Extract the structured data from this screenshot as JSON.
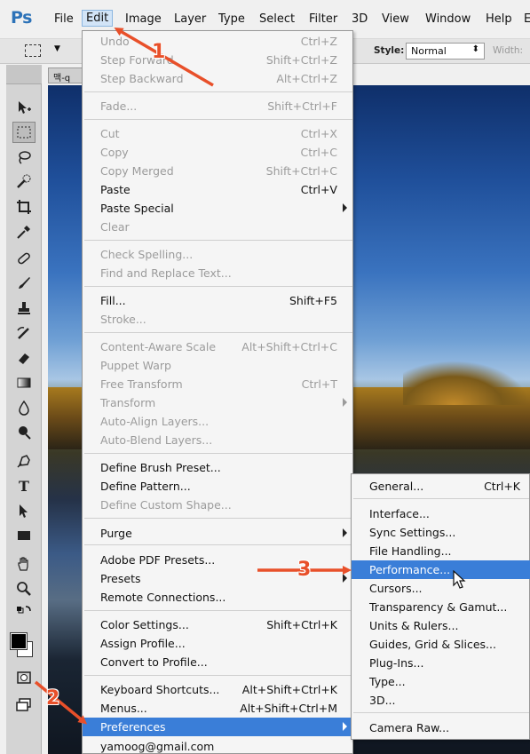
{
  "app": {
    "logo": "Ps"
  },
  "menubar": {
    "items": [
      "File",
      "Edit",
      "Image",
      "Layer",
      "Type",
      "Select",
      "Filter",
      "3D",
      "View",
      "Window",
      "Help",
      "E"
    ]
  },
  "options_bar": {
    "style_label": "Style:",
    "style_value": "Normal",
    "width_label": "Width:"
  },
  "document": {
    "tab_label": "맥-q"
  },
  "edit_menu": {
    "items": [
      {
        "label": "Undo",
        "shortcut": "Ctrl+Z",
        "disabled": true
      },
      {
        "label": "Step Forward",
        "shortcut": "Shift+Ctrl+Z",
        "disabled": true
      },
      {
        "label": "Step Backward",
        "shortcut": "Alt+Ctrl+Z",
        "disabled": true
      },
      {
        "label": "Fade...",
        "shortcut": "Shift+Ctrl+F",
        "disabled": true
      },
      {
        "label": "Cut",
        "shortcut": "Ctrl+X",
        "disabled": true
      },
      {
        "label": "Copy",
        "shortcut": "Ctrl+C",
        "disabled": true
      },
      {
        "label": "Copy Merged",
        "shortcut": "Shift+Ctrl+C",
        "disabled": true
      },
      {
        "label": "Paste",
        "shortcut": "Ctrl+V",
        "disabled": false
      },
      {
        "label": "Paste Special",
        "shortcut": "",
        "disabled": false,
        "submenu": true
      },
      {
        "label": "Clear",
        "shortcut": "",
        "disabled": true
      },
      {
        "label": "Check Spelling...",
        "shortcut": "",
        "disabled": true
      },
      {
        "label": "Find and Replace Text...",
        "shortcut": "",
        "disabled": true
      },
      {
        "label": "Fill...",
        "shortcut": "Shift+F5",
        "disabled": false
      },
      {
        "label": "Stroke...",
        "shortcut": "",
        "disabled": true
      },
      {
        "label": "Content-Aware Scale",
        "shortcut": "Alt+Shift+Ctrl+C",
        "disabled": true
      },
      {
        "label": "Puppet Warp",
        "shortcut": "",
        "disabled": true
      },
      {
        "label": "Free Transform",
        "shortcut": "Ctrl+T",
        "disabled": true
      },
      {
        "label": "Transform",
        "shortcut": "",
        "disabled": true,
        "submenu": true
      },
      {
        "label": "Auto-Align Layers...",
        "shortcut": "",
        "disabled": true
      },
      {
        "label": "Auto-Blend Layers...",
        "shortcut": "",
        "disabled": true
      },
      {
        "label": "Define Brush Preset...",
        "shortcut": "",
        "disabled": false
      },
      {
        "label": "Define Pattern...",
        "shortcut": "",
        "disabled": false
      },
      {
        "label": "Define Custom Shape...",
        "shortcut": "",
        "disabled": true
      },
      {
        "label": "Purge",
        "shortcut": "",
        "disabled": false,
        "submenu": true
      },
      {
        "label": "Adobe PDF Presets...",
        "shortcut": "",
        "disabled": false
      },
      {
        "label": "Presets",
        "shortcut": "",
        "disabled": false,
        "submenu": true
      },
      {
        "label": "Remote Connections...",
        "shortcut": "",
        "disabled": false
      },
      {
        "label": "Color Settings...",
        "shortcut": "Shift+Ctrl+K",
        "disabled": false
      },
      {
        "label": "Assign Profile...",
        "shortcut": "",
        "disabled": false
      },
      {
        "label": "Convert to Profile...",
        "shortcut": "",
        "disabled": false
      },
      {
        "label": "Keyboard Shortcuts...",
        "shortcut": "Alt+Shift+Ctrl+K",
        "disabled": false
      },
      {
        "label": "Menus...",
        "shortcut": "Alt+Shift+Ctrl+M",
        "disabled": false
      },
      {
        "label": "Preferences",
        "shortcut": "",
        "disabled": false,
        "submenu": true,
        "highlighted": true
      },
      {
        "label": "yamoog@gmail.com",
        "shortcut": "",
        "disabled": false
      }
    ]
  },
  "preferences_menu": {
    "items": [
      {
        "label": "General...",
        "shortcut": "Ctrl+K"
      },
      {
        "label": "Interface...",
        "shortcut": ""
      },
      {
        "label": "Sync Settings...",
        "shortcut": ""
      },
      {
        "label": "File Handling...",
        "shortcut": ""
      },
      {
        "label": "Performance...",
        "shortcut": "",
        "highlighted": true
      },
      {
        "label": "Cursors...",
        "shortcut": ""
      },
      {
        "label": "Transparency & Gamut...",
        "shortcut": ""
      },
      {
        "label": "Units & Rulers...",
        "shortcut": ""
      },
      {
        "label": "Guides, Grid & Slices...",
        "shortcut": ""
      },
      {
        "label": "Plug-Ins...",
        "shortcut": ""
      },
      {
        "label": "Type...",
        "shortcut": ""
      },
      {
        "label": "3D...",
        "shortcut": ""
      },
      {
        "label": "Camera Raw...",
        "shortcut": ""
      }
    ]
  },
  "annotations": {
    "steps": [
      "1",
      "2",
      "3"
    ],
    "color": "#e8502a"
  },
  "colors": {
    "highlight": "#3a7ed8",
    "menu_bg": "#f5f5f5",
    "disabled_text": "#9b9b9b"
  }
}
